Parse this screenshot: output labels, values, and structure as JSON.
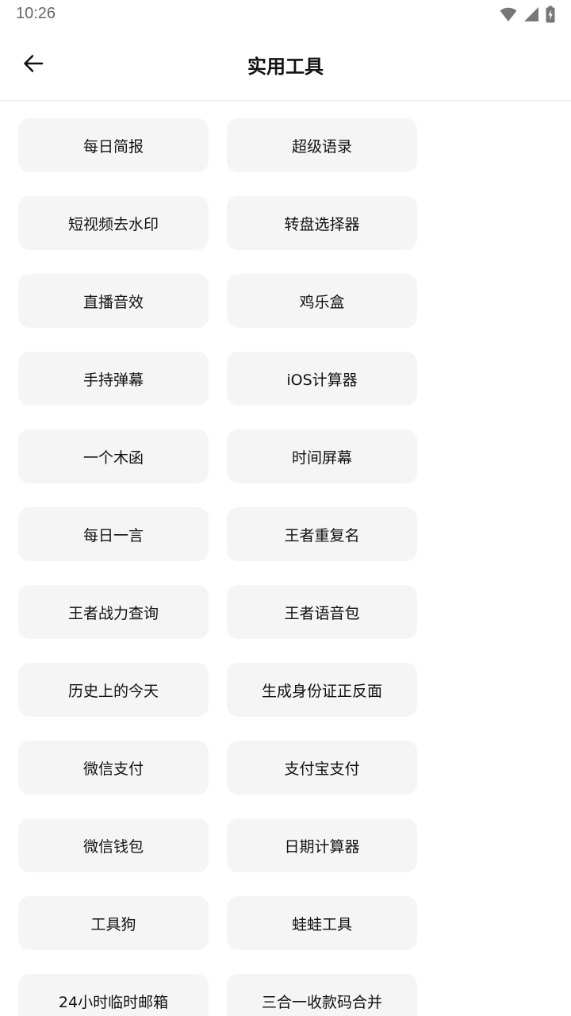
{
  "status_bar": {
    "time": "10:26",
    "icons": [
      "wifi-icon",
      "cellular-signal-icon",
      "battery-charging-icon"
    ]
  },
  "app_bar": {
    "back_icon": "arrow-left-icon",
    "title": "实用工具"
  },
  "tools": [
    {
      "label": "每日简报"
    },
    {
      "label": "超级语录"
    },
    {
      "label": "短视频去水印"
    },
    {
      "label": "转盘选择器"
    },
    {
      "label": "直播音效"
    },
    {
      "label": "鸡乐盒"
    },
    {
      "label": "手持弹幕"
    },
    {
      "label": "iOS计算器"
    },
    {
      "label": "一个木函"
    },
    {
      "label": "时间屏幕"
    },
    {
      "label": "每日一言"
    },
    {
      "label": "王者重复名"
    },
    {
      "label": "王者战力查询"
    },
    {
      "label": "王者语音包"
    },
    {
      "label": "历史上的今天"
    },
    {
      "label": "生成身份证正反面"
    },
    {
      "label": "微信支付"
    },
    {
      "label": "支付宝支付"
    },
    {
      "label": "微信钱包"
    },
    {
      "label": "日期计算器"
    },
    {
      "label": "工具狗"
    },
    {
      "label": "蛙蛙工具"
    },
    {
      "label": "24小时临时邮箱"
    },
    {
      "label": "三合一收款码合并"
    }
  ],
  "colors": {
    "background": "#ffffff",
    "tile": "#f5f5f5",
    "text": "#111111",
    "status_text": "#666666"
  }
}
